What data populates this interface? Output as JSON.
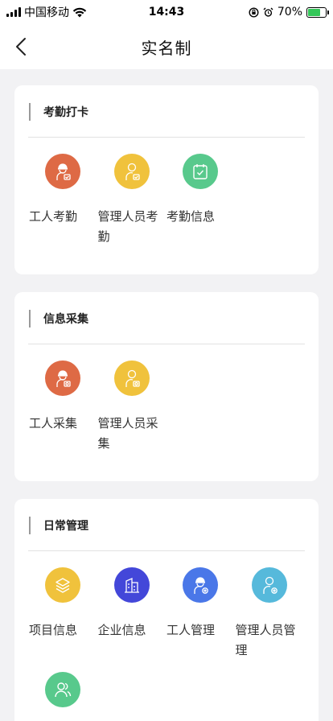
{
  "status_bar": {
    "carrier": "中国移动",
    "time": "14:43",
    "battery": "70%",
    "battery_level": 0.7
  },
  "nav": {
    "title": "实名制",
    "back_icon": "chevron-left-icon"
  },
  "sections": [
    {
      "title": "考勤打卡",
      "items": [
        {
          "label": "工人考勤",
          "icon": "worker-check-icon",
          "color": "#de6a45"
        },
        {
          "label": "管理人员考勤",
          "icon": "manager-check-icon",
          "color": "#f0c23c"
        },
        {
          "label": "考勤信息",
          "icon": "calendar-check-icon",
          "color": "#58c98c"
        }
      ]
    },
    {
      "title": "信息采集",
      "items": [
        {
          "label": "工人采集",
          "icon": "worker-camera-icon",
          "color": "#de6a45"
        },
        {
          "label": "管理人员采集",
          "icon": "manager-camera-icon",
          "color": "#f0c23c"
        }
      ]
    },
    {
      "title": "日常管理",
      "items": [
        {
          "label": "项目信息",
          "icon": "layers-icon",
          "color": "#f0c23c"
        },
        {
          "label": "企业信息",
          "icon": "building-icon",
          "color": "#4347d9"
        },
        {
          "label": "工人管理",
          "icon": "worker-gear-icon",
          "color": "#4a77e8"
        },
        {
          "label": "管理人员管理",
          "icon": "manager-gear-icon",
          "color": "#56b9db"
        },
        {
          "label": "",
          "icon": "users-icon",
          "color": "#58c98c"
        }
      ]
    }
  ]
}
